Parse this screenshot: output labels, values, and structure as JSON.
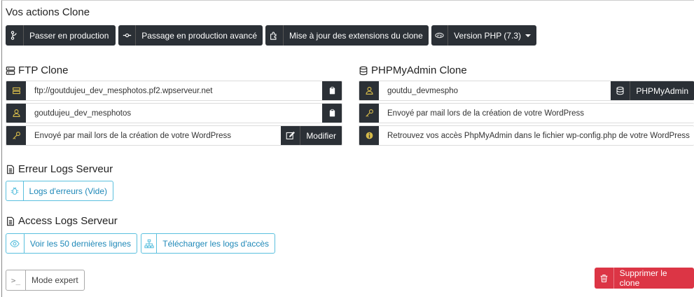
{
  "header": {
    "title": "Vos actions Clone"
  },
  "toolbar": {
    "production": "Passer en production",
    "advanced": "Passage en production avancé",
    "extensions": "Mise à jour des extensions du clone",
    "php_version": "Version PHP (7.3)"
  },
  "ftp": {
    "title": "FTP Clone",
    "host": "ftp://goutdujeu_dev_mesphotos.pf2.wpserveur.net",
    "user": "goutdujeu_dev_mesphotos",
    "password": "Envoyé par mail lors de la création de votre WordPress",
    "modify": "Modifier"
  },
  "pma": {
    "title": "PHPMyAdmin Clone",
    "user": "goutdu_devmespho",
    "open": "PHPMyAdmin",
    "password": "Envoyé par mail lors de la création de votre WordPress",
    "info": "Retrouvez vos accès PhpMyAdmin dans le fichier wp-config.php de votre WordPress"
  },
  "error_logs": {
    "title": "Erreur Logs Serveur",
    "button": "Logs d'erreurs (Vide)"
  },
  "access_logs": {
    "title": "Access Logs Serveur",
    "view": "Voir les 50 dernières lignes",
    "download": "Télécharger les logs d'accès"
  },
  "footer": {
    "expert": "Mode expert",
    "delete": "Supprimer le clone"
  },
  "colors": {
    "dark": "#2b3036",
    "field_icon": "#d4b94a",
    "info": "#5bc0de",
    "danger": "#dc3545"
  }
}
